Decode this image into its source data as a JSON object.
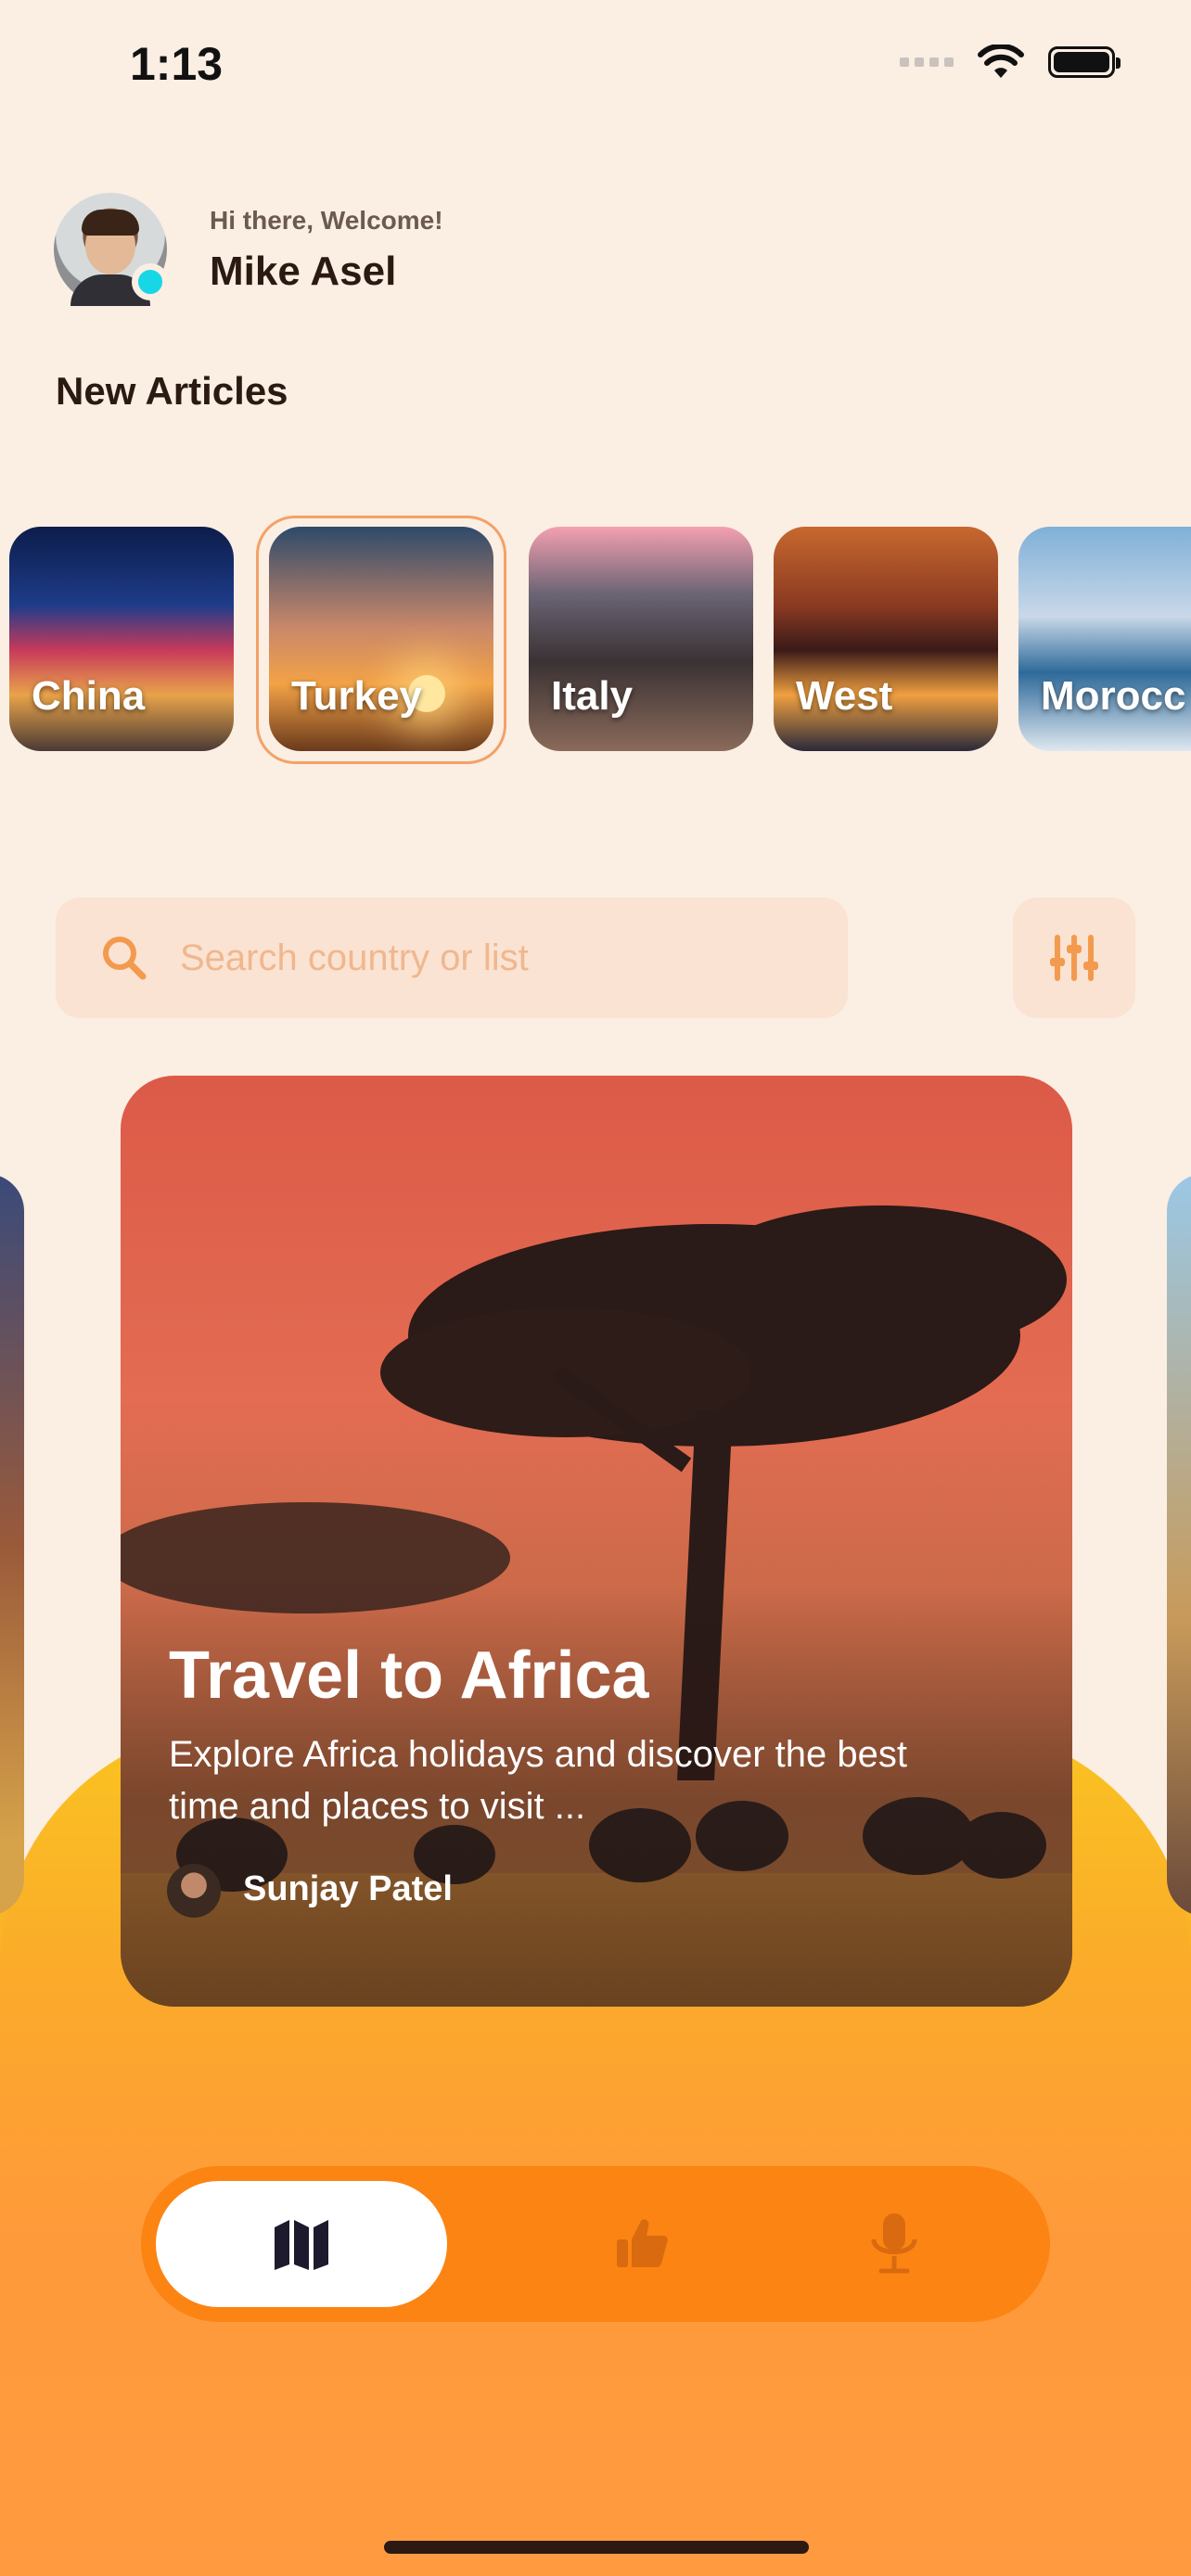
{
  "status_bar": {
    "time": "1:13"
  },
  "header": {
    "greeting": "Hi there, Welcome!",
    "user_name": "Mike Asel"
  },
  "section_title": "New Articles",
  "countries": [
    {
      "label": "China",
      "selected": false
    },
    {
      "label": "Turkey",
      "selected": true
    },
    {
      "label": "Italy",
      "selected": false
    },
    {
      "label": "West",
      "selected": false
    },
    {
      "label": "Morocc",
      "selected": false
    }
  ],
  "search": {
    "placeholder": "Search country or list"
  },
  "featured_card": {
    "title": "Travel to Africa",
    "description": "Explore Africa holidays and discover the best time and places to visit ...",
    "author": "Sunjay Patel"
  },
  "tabs": [
    {
      "icon": "map-icon",
      "active": true
    },
    {
      "icon": "thumbs-up-icon",
      "active": false
    },
    {
      "icon": "microphone-icon",
      "active": false
    }
  ],
  "colors": {
    "background": "#fbeee3",
    "accent": "#fb8413",
    "search_bg": "#fae3d2",
    "online": "#17d7e6"
  }
}
